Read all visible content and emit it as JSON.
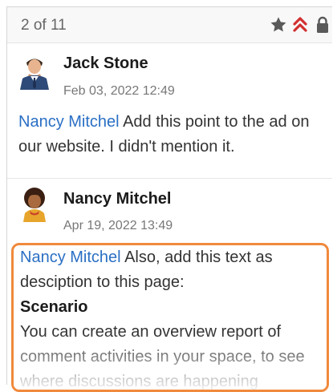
{
  "toolbar": {
    "counter": "2 of 11",
    "icons": [
      "star-icon",
      "priority-up-icon",
      "lock-icon"
    ],
    "priority_color": "#d32f2f"
  },
  "comments": [
    {
      "author": "Jack Stone",
      "date": "Feb 03, 2022 12:49",
      "avatar": "man-in-suit-avatar",
      "mention": "Nancy Mitchel",
      "text": " Add this point to the ad on our website. I didn't mention it."
    },
    {
      "author": "Nancy Mitchel",
      "date": "Apr 19, 2022 13:49",
      "avatar": "woman-avatar",
      "mention": "Nancy Mitchel",
      "text": " Also, add this text as desciption to this page:",
      "heading": "Scenario",
      "paragraph": "You can create an overview report of comment activities in your space, to see where discussions are happening"
    }
  ],
  "highlight_color": "#f08a3c",
  "mention_color": "#2a6fc4"
}
